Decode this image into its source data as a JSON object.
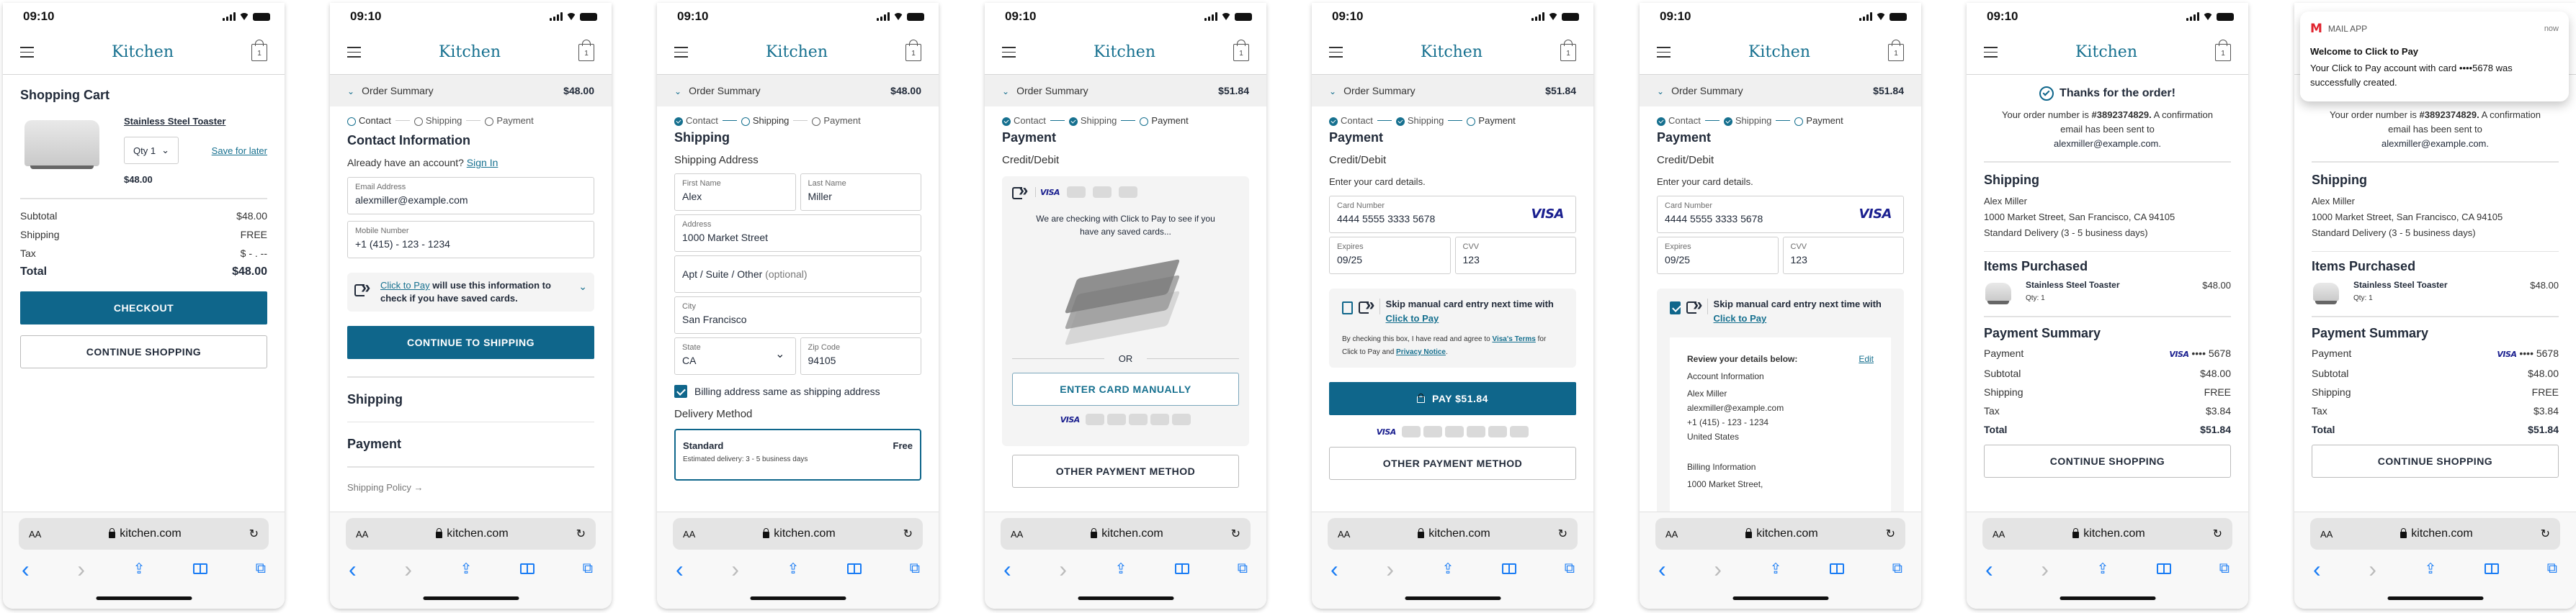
{
  "common": {
    "time": "09:10",
    "logo": "Kitchen",
    "bag_count": "1",
    "url": "kitchen.com",
    "aa": "AA",
    "steps": [
      "Contact",
      "Shipping",
      "Payment"
    ],
    "order_summary_label": "Order Summary",
    "icons": {
      "menu": "hamburger-icon",
      "bag": "shopping-bag-icon",
      "back": "‹",
      "forward": "›",
      "share": "⇪",
      "bookmarks": "📖",
      "tabs": "⧉",
      "reload": "↻"
    }
  },
  "screens": {
    "cart": {
      "title": "Shopping Cart",
      "product_name": "Stainless Steel Toaster",
      "qty_label": "Qty 1",
      "save_for_later": "Save for later",
      "price": "$48.00",
      "rows": [
        {
          "label": "Subtotal",
          "value": "$48.00"
        },
        {
          "label": "Shipping",
          "value": "FREE"
        },
        {
          "label": "Tax",
          "value": "$ - . --"
        }
      ],
      "total_label": "Total",
      "total_value": "$48.00",
      "checkout": "CHECKOUT",
      "continue": "CONTINUE SHOPPING"
    },
    "contact": {
      "order_total": "$48.00",
      "title": "Contact Information",
      "account_prompt": "Already have an account?",
      "sign_in": "Sign In",
      "email_label": "Email Address",
      "email_value": "alexmiller@example.com",
      "mobile_label": "Mobile Number",
      "mobile_value": "+1 (415) - 123 - 1234",
      "ctp_link": "Click to Pay",
      "ctp_text": "will use this information to check if you have saved cards.",
      "continue": "CONTINUE TO SHIPPING",
      "section_shipping": "Shipping",
      "section_payment": "Payment",
      "shipping_policy": "Shipping Policy →"
    },
    "shipping": {
      "order_total": "$48.00",
      "title": "Shipping",
      "address_heading": "Shipping Address",
      "first_name_label": "First Name",
      "first_name": "Alex",
      "last_name_label": "Last Name",
      "last_name": "Miller",
      "address_label": "Address",
      "address": "1000 Market Street",
      "apt_placeholder": "Apt / Suite / Other",
      "apt_optional": "(optional)",
      "city_label": "City",
      "city": "San Francisco",
      "state_label": "State",
      "state": "CA",
      "zip_label": "Zip Code",
      "zip": "94105",
      "billing_same": "Billing address same as shipping address",
      "billing_same_checked": true,
      "delivery_heading": "Delivery Method",
      "delivery_name": "Standard",
      "delivery_price": "Free",
      "delivery_estimate": "Estimated delivery: 3 - 5 business days"
    },
    "payment_checking": {
      "order_total": "$51.84",
      "title": "Payment",
      "method": "Credit/Debit",
      "visa": "VISA",
      "checking_text": "We are checking with Click to Pay to see if you have any saved cards...",
      "or": "OR",
      "enter_manually": "ENTER CARD MANUALLY",
      "other_method": "OTHER PAYMENT METHOD"
    },
    "payment_manual": {
      "order_total": "$51.84",
      "title": "Payment",
      "method": "Credit/Debit",
      "instructions": "Enter your card details.",
      "card_label": "Card Number",
      "card_number": "4444 5555 3333 5678",
      "visa": "VISA",
      "expires_label": "Expires",
      "expires": "09/25",
      "cvv_label": "CVV",
      "cvv": "123",
      "skip_text": "Skip manual card entry next time with",
      "ctp_link": "Click to Pay",
      "skip_checked": false,
      "terms_prefix": "By checking this box, I have read and agree to",
      "visa_terms": "Visa's Terms",
      "terms_mid": "for Click to Pay and",
      "privacy": "Privacy Notice",
      "pay": "PAY $51.84",
      "other_method": "OTHER PAYMENT METHOD"
    },
    "payment_review": {
      "order_total": "$51.84",
      "title": "Payment",
      "method": "Credit/Debit",
      "instructions": "Enter your card details.",
      "card_label": "Card Number",
      "card_number": "4444 5555 3333 5678",
      "visa": "VISA",
      "expires_label": "Expires",
      "expires": "09/25",
      "cvv_label": "CVV",
      "cvv": "123",
      "skip_text": "Skip manual card entry next time with",
      "ctp_link": "Click to Pay",
      "skip_checked": true,
      "review_heading": "Review your details below:",
      "edit": "Edit",
      "account_heading": "Account Information",
      "account_lines": [
        "Alex Miller",
        "alexmiller@example.com",
        "+1 (415) - 123 - 1234",
        "United States"
      ],
      "billing_heading": "Billing Information",
      "billing_line": "1000 Market Street,"
    },
    "confirmation": {
      "thanks": "Thanks for the order!",
      "order_prefix": "Your order number is",
      "order_number": "#3892374829.",
      "order_suffix": "A confirmation email has been sent to",
      "email": "alexmiller@example.com.",
      "shipping_heading": "Shipping",
      "shipping_lines": [
        "Alex Miller",
        "1000 Market Street, San Francisco, CA 94105",
        "Standard Delivery (3 - 5 business days)"
      ],
      "items_heading": "Items Purchased",
      "item_name": "Stainless Steel Toaster",
      "item_qty": "Qty: 1",
      "item_price": "$48.00",
      "payment_heading": "Payment Summary",
      "payment_label": "Payment",
      "payment_visa": "VISA",
      "payment_card": "•••• 5678",
      "rows": [
        {
          "label": "Subtotal",
          "value": "$48.00"
        },
        {
          "label": "Shipping",
          "value": "FREE"
        },
        {
          "label": "Tax",
          "value": "$3.84"
        }
      ],
      "total_label": "Total",
      "total_value": "$51.84",
      "continue": "CONTINUE SHOPPING"
    },
    "notification": {
      "app": "MAIL APP",
      "time": "now",
      "title": "Welcome to Click to Pay",
      "body": "Your Click to Pay account with card ••••5678 was successfully created.",
      "brand_color": "#e0232e"
    }
  },
  "colors": {
    "primary": "#0f668b",
    "link": "#16708f",
    "text": "#222b3a",
    "visa": "#1a1f8f"
  }
}
